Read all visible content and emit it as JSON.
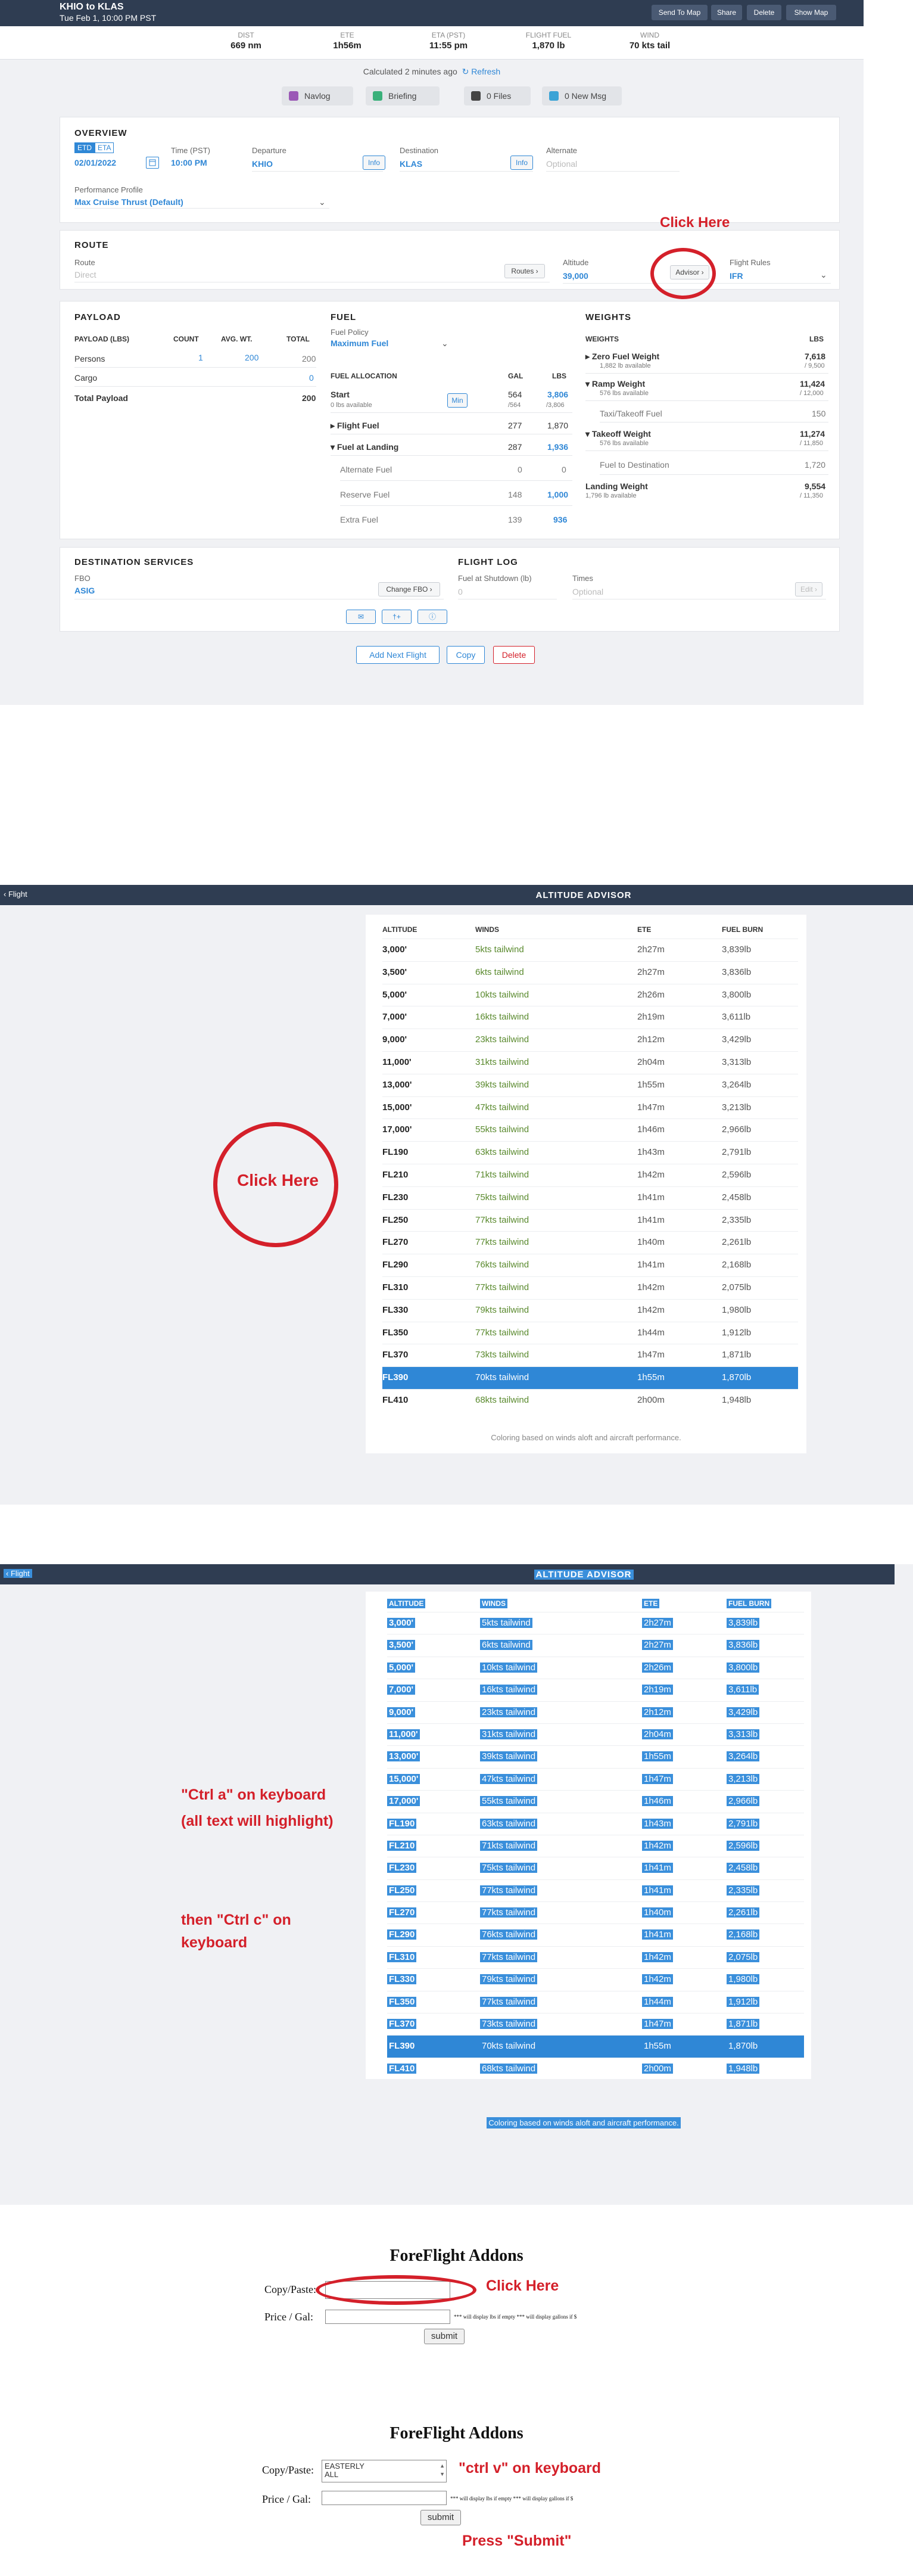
{
  "flight": {
    "title": "KHIO to KLAS",
    "datetime": "Tue Feb 1, 10:00 PM PST",
    "actions": [
      "Send To Map",
      "Share",
      "Delete",
      "Show Map"
    ],
    "stats": [
      {
        "label": "DIST",
        "value": "669 nm"
      },
      {
        "label": "ETE",
        "value": "1h56m"
      },
      {
        "label": "ETA (PST)",
        "value": "11:55 pm"
      },
      {
        "label": "FLIGHT FUEL",
        "value": "1,870 lb"
      },
      {
        "label": "WIND",
        "value": "70 kts tail"
      }
    ],
    "calculated": "Calculated 2 minutes ago",
    "refresh": "Refresh",
    "tabs": [
      "Navlog",
      "Briefing",
      "0 Files",
      "0 New Msg"
    ]
  },
  "overview": {
    "heading": "OVERVIEW",
    "etd": "ETD",
    "eta": "ETA",
    "date": "02/01/2022",
    "time_label": "Time (PST)",
    "time": "10:00 PM",
    "departure_label": "Departure",
    "departure": "KHIO",
    "info": "Info",
    "destination_label": "Destination",
    "destination": "KLAS",
    "alternate_label": "Alternate",
    "alternate_ph": "Optional",
    "profile_label": "Performance Profile",
    "profile": "Max Cruise Thrust (Default)"
  },
  "route": {
    "heading": "ROUTE",
    "route_label": "Route",
    "route_ph": "Direct",
    "routes_btn": "Routes ›",
    "altitude_label": "Altitude",
    "altitude": "39,000",
    "advisor_btn": "Advisor ›",
    "rules_label": "Flight Rules",
    "rules": "IFR"
  },
  "payload": {
    "heading": "PAYLOAD",
    "cols": [
      "PAYLOAD (LBS)",
      "COUNT",
      "AVG. WT.",
      "TOTAL"
    ],
    "rows": [
      {
        "name": "Persons",
        "count": "1",
        "avg": "200",
        "total": "200"
      },
      {
        "name": "Cargo",
        "count": "",
        "avg": "",
        "total": "0"
      }
    ],
    "total_label": "Total Payload",
    "total": "200"
  },
  "fuel": {
    "heading": "FUEL",
    "policy_label": "Fuel Policy",
    "policy": "Maximum Fuel",
    "cols": [
      "FUEL ALLOCATION",
      "GAL",
      "LBS"
    ],
    "start_label": "Start",
    "start_sub": "0 lbs available",
    "min_btn": "Min",
    "start_gal": "564",
    "start_gal_sub": "/564",
    "start_lbs": "3,806",
    "start_lbs_sub": "/3,806",
    "flight_fuel_label": "Flight Fuel",
    "flight_fuel_gal": "277",
    "flight_fuel_lbs": "1,870",
    "landing_label": "Fuel at Landing",
    "landing_gal": "287",
    "landing_lbs": "1,936",
    "alt_label": "Alternate Fuel",
    "alt_gal": "0",
    "alt_lbs": "0",
    "reserve_label": "Reserve Fuel",
    "reserve_gal": "148",
    "reserve_lbs": "1,000",
    "extra_label": "Extra Fuel",
    "extra_gal": "139",
    "extra_lbs": "936"
  },
  "weights": {
    "heading": "WEIGHTS",
    "col1": "WEIGHTS",
    "col2": "LBS",
    "zfw_label": "Zero Fuel Weight",
    "zfw_sub": "1,882 lb available",
    "zfw": "7,618",
    "zfw_max": "/ 9,500",
    "ramp_label": "Ramp Weight",
    "ramp_sub": "576 lbs available",
    "ramp": "11,424",
    "ramp_max": "/ 12,000",
    "taxi_label": "Taxi/Takeoff Fuel",
    "taxi": "150",
    "to_label": "Takeoff Weight",
    "to_sub": "576 lbs available",
    "to": "11,274",
    "to_max": "/ 11,850",
    "dest_label": "Fuel to Destination",
    "dest": "1,720",
    "land_label": "Landing Weight",
    "land_sub": "1,796 lb available",
    "land": "9,554",
    "land_max": "/ 11,350"
  },
  "dest_services": {
    "heading": "DESTINATION SERVICES",
    "fbo_label": "FBO",
    "fbo": "ASIG",
    "change_btn": "Change FBO ›"
  },
  "flight_log": {
    "heading": "FLIGHT LOG",
    "shutdown_label": "Fuel at Shutdown (lb)",
    "shutdown_ph": "0",
    "times_label": "Times",
    "times_ph": "Optional",
    "edit_btn": "Edit ›"
  },
  "footer_buttons": [
    "Add Next Flight",
    "Copy",
    "Delete"
  ],
  "annotations": {
    "click_here": "Click Here",
    "ctrl_a": "\"Ctrl a\" on keyboard",
    "ctrl_a_2": "(all text will highlight)",
    "ctrl_c": "then \"Ctrl c\" on",
    "ctrl_c_2": "keyboard",
    "ctrl_v": "\"ctrl v\" on keyboard",
    "press_submit": "Press \"Submit\""
  },
  "advisor": {
    "back": "‹ Flight",
    "title": "ALTITUDE ADVISOR",
    "cols": [
      "ALTITUDE",
      "WINDS",
      "ETE",
      "FUEL BURN"
    ],
    "rows": [
      [
        "3,000'",
        "5kts tailwind",
        "2h27m",
        "3,839lb"
      ],
      [
        "3,500'",
        "6kts tailwind",
        "2h27m",
        "3,836lb"
      ],
      [
        "5,000'",
        "10kts tailwind",
        "2h26m",
        "3,800lb"
      ],
      [
        "7,000'",
        "16kts tailwind",
        "2h19m",
        "3,611lb"
      ],
      [
        "9,000'",
        "23kts tailwind",
        "2h12m",
        "3,429lb"
      ],
      [
        "11,000'",
        "31kts tailwind",
        "2h04m",
        "3,313lb"
      ],
      [
        "13,000'",
        "39kts tailwind",
        "1h55m",
        "3,264lb"
      ],
      [
        "15,000'",
        "47kts tailwind",
        "1h47m",
        "3,213lb"
      ],
      [
        "17,000'",
        "55kts tailwind",
        "1h46m",
        "2,966lb"
      ],
      [
        "FL190",
        "63kts tailwind",
        "1h43m",
        "2,791lb"
      ],
      [
        "FL210",
        "71kts tailwind",
        "1h42m",
        "2,596lb"
      ],
      [
        "FL230",
        "75kts tailwind",
        "1h41m",
        "2,458lb"
      ],
      [
        "FL250",
        "77kts tailwind",
        "1h41m",
        "2,335lb"
      ],
      [
        "FL270",
        "77kts tailwind",
        "1h40m",
        "2,261lb"
      ],
      [
        "FL290",
        "76kts tailwind",
        "1h41m",
        "2,168lb"
      ],
      [
        "FL310",
        "77kts tailwind",
        "1h42m",
        "2,075lb"
      ],
      [
        "FL330",
        "79kts tailwind",
        "1h42m",
        "1,980lb"
      ],
      [
        "FL350",
        "77kts tailwind",
        "1h44m",
        "1,912lb"
      ],
      [
        "FL370",
        "73kts tailwind",
        "1h47m",
        "1,871lb"
      ],
      [
        "FL390",
        "70kts tailwind",
        "1h55m",
        "1,870lb"
      ],
      [
        "FL410",
        "68kts tailwind",
        "2h00m",
        "1,948lb"
      ]
    ],
    "selected_index": 19,
    "note": "Coloring based on winds aloft and aircraft performance."
  },
  "addons": {
    "title": "ForeFlight Addons",
    "copy_label": "Copy/Paste:",
    "price_label": "Price / Gal:",
    "hint": "*** will display lbs if empty *** will display gallons if $",
    "submit": "submit",
    "pasted_line1": "EASTERLY",
    "pasted_line2": "ALL"
  },
  "colors": {
    "navy": "#2f3d52",
    "accent": "#2f87d6",
    "wind_green": "#5a8a2e",
    "annotation_red": "#d4202a",
    "selected_row": "#2f87d6"
  }
}
